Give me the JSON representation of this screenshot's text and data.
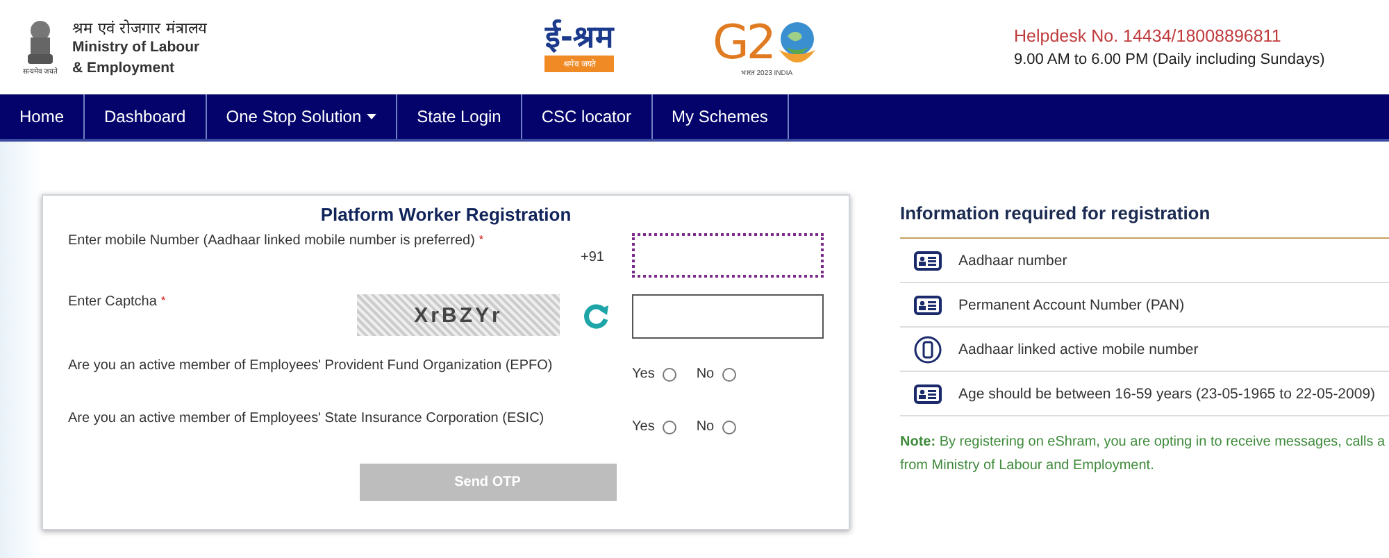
{
  "header": {
    "emblem_motto": "सत्यमेव जयते",
    "ministry_hindi": "श्रम एवं रोजगार मंत्रालय",
    "ministry_english": [
      "Ministry of Labour",
      "& Employment"
    ],
    "eshram_logo": {
      "title": "ई-श्रम",
      "motto": "श्रमेव जयते"
    },
    "g20_logo": {
      "letters": "G2",
      "caption": "भारत 2023 INDIA"
    },
    "helpdesk": "Helpdesk No. 14434/18008896811",
    "hours": "9.00 AM to 6.00 PM (Daily including Sundays)"
  },
  "nav": [
    {
      "label": "Home",
      "dropdown": false
    },
    {
      "label": "Dashboard",
      "dropdown": false
    },
    {
      "label": "One Stop Solution",
      "dropdown": true
    },
    {
      "label": "State Login",
      "dropdown": false
    },
    {
      "label": "CSC locator",
      "dropdown": false
    },
    {
      "label": "My Schemes",
      "dropdown": false
    }
  ],
  "form": {
    "title": "Platform Worker Registration",
    "mobile": {
      "label": "Enter mobile Number (Aadhaar linked mobile number is preferred)",
      "required_mark": "*",
      "prefix": "+91",
      "focused": true
    },
    "captcha": {
      "label": "Enter Captcha",
      "required_mark": "*",
      "code": "XrBZYr"
    },
    "questions": [
      {
        "label": "Are you an active member of Employees' Provident Fund Organization (EPFO)",
        "options": [
          {
            "label": "Yes",
            "selected": false
          },
          {
            "label": "No",
            "selected": false
          }
        ]
      },
      {
        "label": "Are you an active member of Employees' State Insurance Corporation (ESIC)",
        "options": [
          {
            "label": "Yes",
            "selected": false
          },
          {
            "label": "No",
            "selected": false
          }
        ]
      }
    ],
    "submit": {
      "label": "Send OTP",
      "disabled": true
    }
  },
  "info": {
    "title": "Information required for registration",
    "items": [
      {
        "kind": "card",
        "text": "Aadhaar number"
      },
      {
        "kind": "card",
        "text": "Permanent Account Number (PAN)"
      },
      {
        "kind": "phone",
        "text": "Aadhaar linked active mobile number"
      },
      {
        "kind": "card",
        "text": "Age should be between 16-59 years (23-05-1965 to 22-05-2009)"
      }
    ],
    "note": {
      "label": "Note:",
      "lines": [
        "By registering on eShram, you are opting in to receive messages, calls a",
        "from Ministry of Labour and Employment."
      ]
    }
  }
}
